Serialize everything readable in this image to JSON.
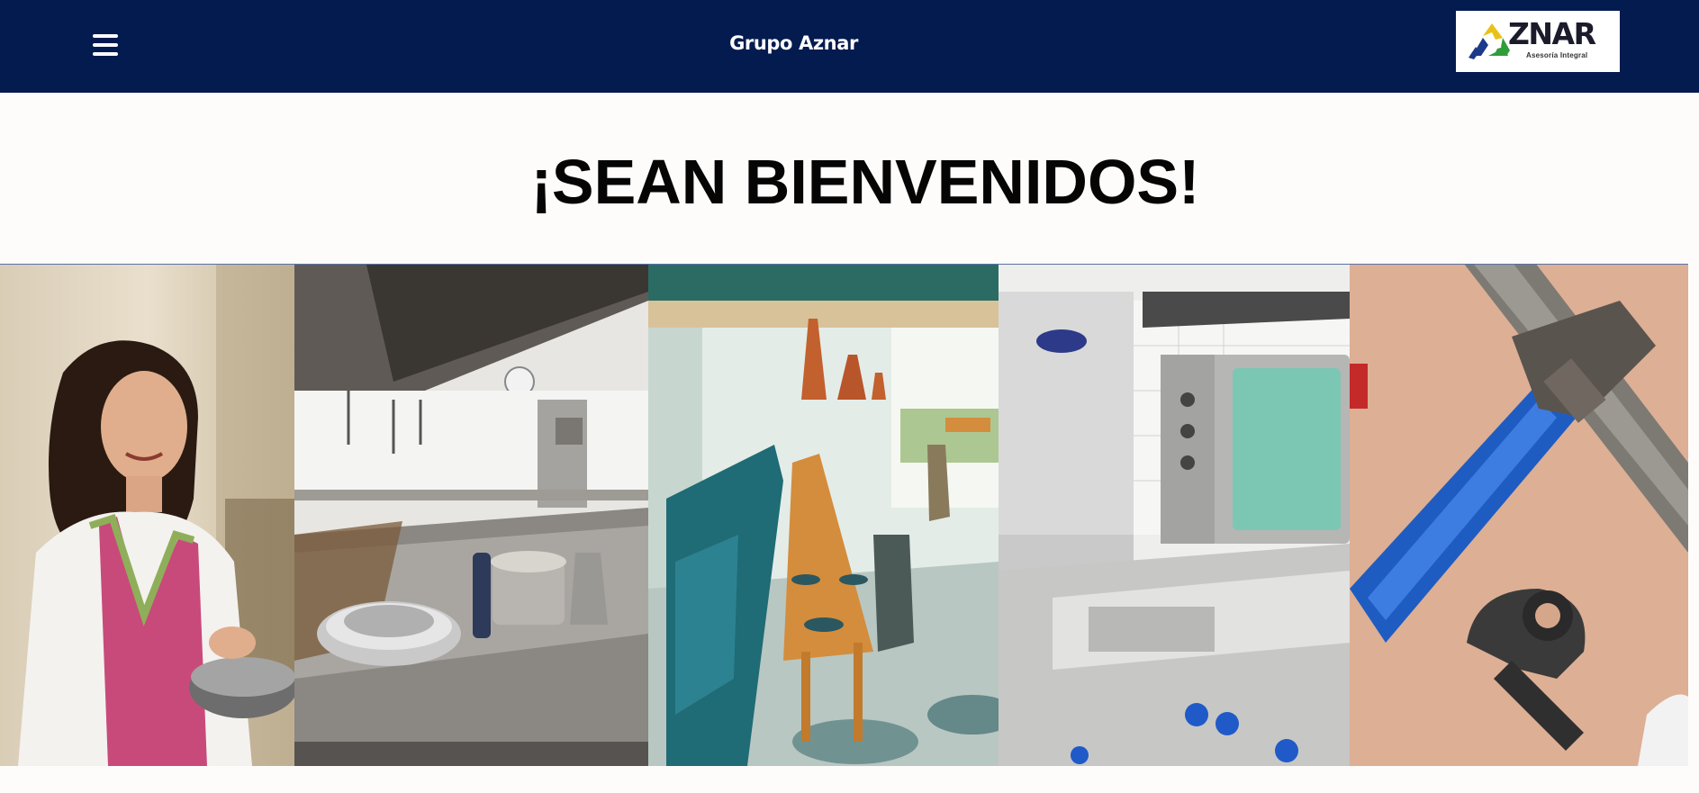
{
  "header": {
    "menu_icon": "hamburger-menu-icon",
    "site_title": "Grupo Aznar",
    "logo": {
      "text": "ZNAR",
      "subtext": "Asesoría Integral"
    },
    "background_color": "#041b4f"
  },
  "hero": {
    "title": "¡SEAN BIENVENIDOS!"
  },
  "banner": {
    "panels": [
      {
        "subject": "woman cooking in kitchen"
      },
      {
        "subject": "stainless steel kitchen counter with bowls"
      },
      {
        "subject": "restaurant dining room with tables"
      },
      {
        "subject": "industrial kitchen equipment and oven"
      },
      {
        "subject": "pipe wrench and pipe cutter tools"
      }
    ]
  }
}
